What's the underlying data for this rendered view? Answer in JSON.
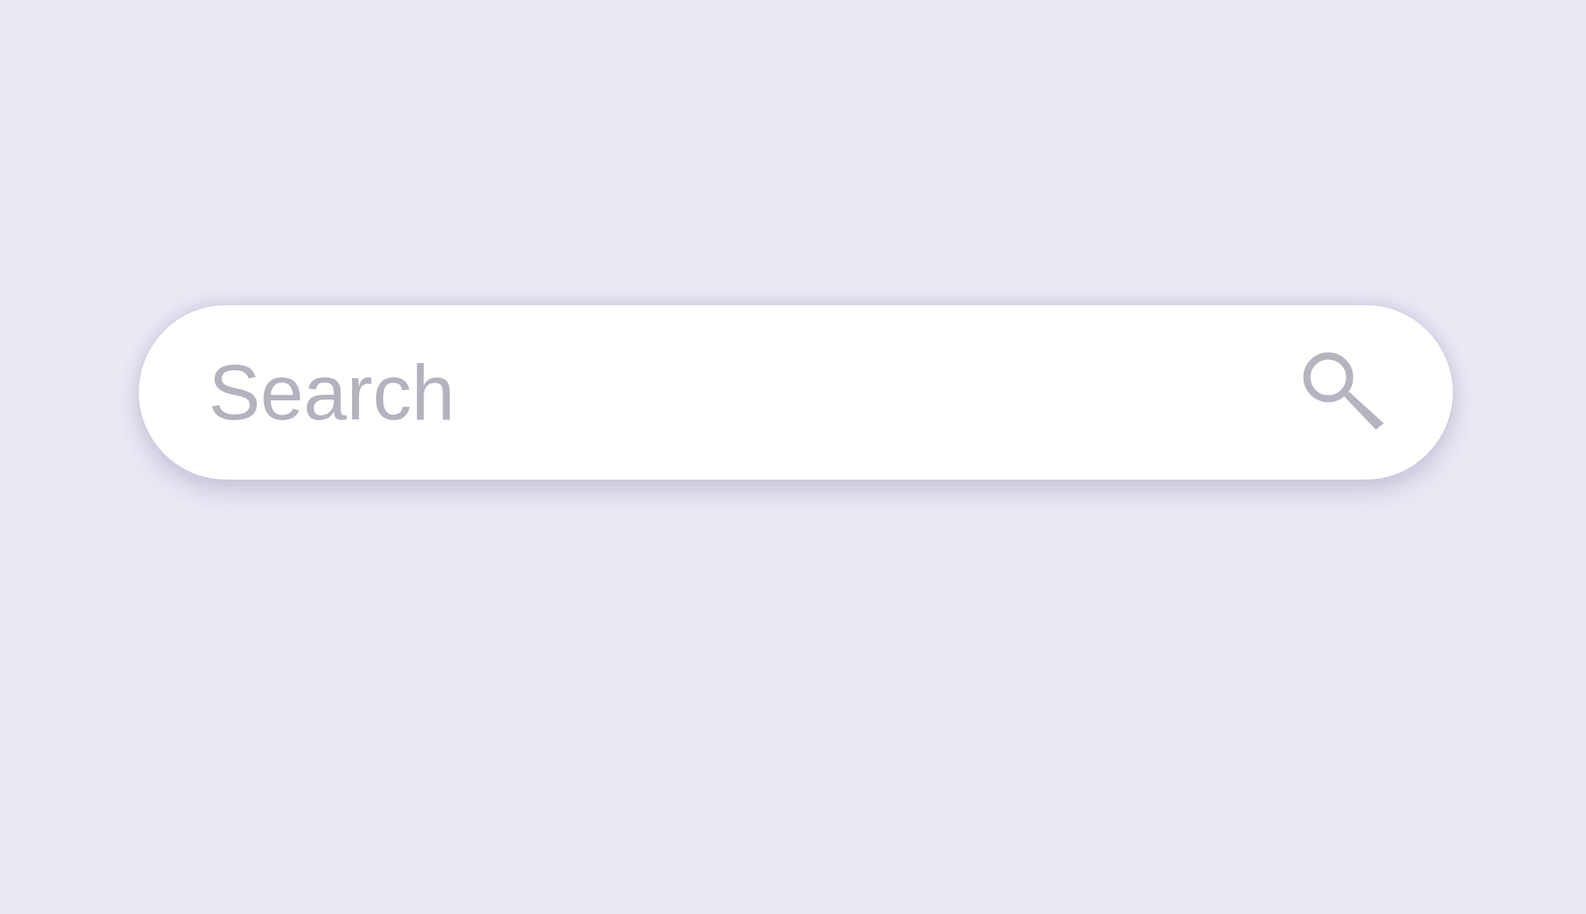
{
  "search": {
    "placeholder": "Search"
  }
}
